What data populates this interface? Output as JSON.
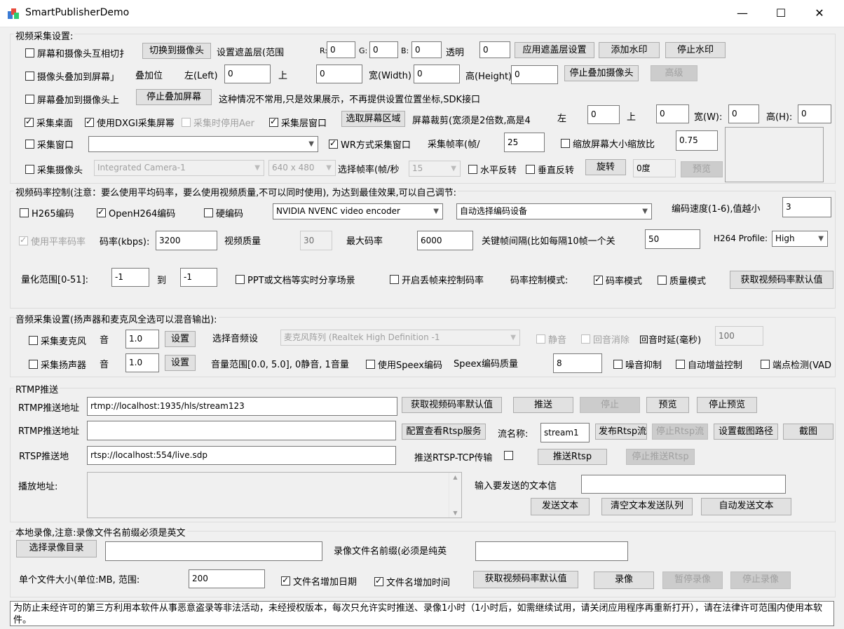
{
  "window": {
    "title": "SmartPublisherDemo"
  },
  "video_capture": {
    "group_label": "视频采集设置:",
    "swap_check": "屏幕和摄像头互相切扌",
    "switch_camera_btn": "切换到摄像头",
    "mask_range_label": "设置遮盖层(范围",
    "r_label": "R:",
    "r_value": "0",
    "g_label": "G:",
    "g_value": "0",
    "b_label": "B:",
    "b_value": "0",
    "alpha_label": "透明",
    "alpha_value": "0",
    "apply_mask_btn": "应用遮盖层设置",
    "add_watermark_btn": "添加水印",
    "stop_watermark_btn": "停止水印",
    "camera_overlay_check": "摄像头叠加到屏幕」",
    "overlay_pos_label": "叠加位",
    "left_label": "左(Left)",
    "left_value": "0",
    "up_label": "上",
    "up_value": "0",
    "width_label": "宽(Width)",
    "width_value": "0",
    "height_label": "高(Height)",
    "height_value": "0",
    "stop_overlay_camera_btn": "停止叠加摄像头",
    "advanced_btn": "高级",
    "screen_overlay_check": "屏幕叠加到摄像头上",
    "stop_overlay_screen_btn": "停止叠加屏幕",
    "overlay_note": "这种情况不常用,只是效果展示，不再提供设置位置坐标,SDK接口",
    "capture_desktop_check": "采集桌面",
    "use_dxgi_check": "使用DXGI采集屏幂",
    "disable_aero_check": "采集时停用Aer",
    "capture_layer_check": "采集层窗口",
    "select_region_btn": "选取屏幕区域",
    "crop_label": "屏幕裁剪(宽须是2倍数,高是4",
    "crop_left_label": "左",
    "crop_left_value": "0",
    "crop_up_label": "上",
    "crop_up_value": "0",
    "crop_w_label": "宽(W):",
    "crop_w_value": "0",
    "crop_h_label": "高(H):",
    "crop_h_value": "0",
    "capture_window_check": "采集窗口",
    "window_select": "",
    "wr_check": "WR方式采集窗口",
    "fps_label": "采集帧率(帧/",
    "fps_value": "25",
    "scale_check": "缩放屏幕大小缩放比",
    "scale_value": "0.75",
    "capture_camera_check": "采集摄像头",
    "camera_select": "Integrated Camera-1",
    "resolution_select": "640 x 480",
    "select_fps_label": "选择帧率(帧/秒",
    "select_fps_value": "15",
    "hflip_check": "水平反转",
    "vflip_check": "垂直反转",
    "rotate_btn": "旋转",
    "rotate_value": "0度",
    "preview_btn": "预览"
  },
  "bitrate": {
    "group_label": "视频码率控制(注意：要么使用平均码率，要么使用视频质量,不可以同时使用), 为达到最佳效果,可以自己调节:",
    "h265_check": "H265编码",
    "openh264_check": "OpenH264编码",
    "hw_check": "硬编码",
    "encoder_select": "NVIDIA NVENC video encoder",
    "device_select": "自动选择编码设备",
    "speed_label": "编码速度(1-6),值越小",
    "speed_value": "3",
    "avg_bitrate_check": "使用平率码率",
    "bitrate_label": "码率(kbps):",
    "bitrate_value": "3200",
    "quality_label": "视频质量",
    "quality_value": "30",
    "max_bitrate_label": "最大码率",
    "max_bitrate_value": "6000",
    "keyframe_label": "关键帧间隔(比如每隔10帧一个关",
    "keyframe_value": "50",
    "profile_label": "H264 Profile:",
    "profile_value": "High",
    "quant_label": "量化范围[0-51]:",
    "quant_min": "-1",
    "to_label": "到",
    "quant_max": "-1",
    "ppt_check": "PPT或文档等实时分享场景",
    "drop_frame_check": "开启丢帧来控制码率",
    "rc_mode_label": "码率控制模式:",
    "rc_bitrate_check": "码率模式",
    "rc_quality_check": "质量模式",
    "get_default_btn": "获取视频码率默认值"
  },
  "audio": {
    "group_label": "音频采集设置(扬声器和麦克风全选可以混音输出):",
    "mic_check": "采集麦克风",
    "mic_vol_label": "音",
    "mic_vol_value": "1.0",
    "mic_set_btn": "设置",
    "audio_dev_label": "选择音频设",
    "audio_dev_select": "麦克风阵列 (Realtek High Definition -1",
    "mute_check": "静音",
    "echo_cancel_check": "回音消除",
    "echo_delay_label": "回音时延(毫秒)",
    "echo_delay_value": "100",
    "speaker_check": "采集扬声器",
    "spk_vol_label": "音",
    "spk_vol_value": "1.0",
    "spk_set_btn": "设置",
    "vol_range_label": "音量范围[0.0, 5.0], 0静音, 1音量",
    "speex_check": "使用Speex编码",
    "speex_quality_label": "Speex编码质量",
    "speex_quality_value": "8",
    "noise_check": "噪音抑制",
    "agc_check": "自动增益控制",
    "vad_check": "端点检测(VAD"
  },
  "rtmp": {
    "group_label": "RTMP推送",
    "url1_label": "RTMP推送地址",
    "url1_value": "rtmp://localhost:1935/hls/stream123",
    "get_default_btn": "获取视频码率默认值",
    "push_btn": "推送",
    "stop_btn": "停止",
    "preview_btn": "预览",
    "stop_preview_btn": "停止预览",
    "url2_label": "RTMP推送地址",
    "url2_value": "",
    "rtsp_service_btn": "配置查看Rtsp服务",
    "stream_name_label": "流名称:",
    "stream_name_value": "stream1",
    "publish_rtsp_btn": "发布Rtsp流",
    "stop_rtsp_btn": "停止Rtsp流",
    "snapshot_path_btn": "设置截图路径",
    "snapshot_btn": "截图",
    "rtsp_label": "RTSP推送地",
    "rtsp_value": "rtsp://localhost:554/live.sdp",
    "rtsp_tcp_label": "推送RTSP-TCP传输",
    "push_rtsp_btn": "推送Rtsp",
    "stop_push_rtsp_btn": "停止推送Rtsp",
    "play_url_label": "播放地址:",
    "text_input_label": "输入要发送的文本信",
    "text_input_value": "",
    "send_text_btn": "发送文本",
    "clear_text_btn": "清空文本发送队列",
    "auto_send_btn": "自动发送文本"
  },
  "record": {
    "group_label": "本地录像,注意:录像文件名前缀必须是英文",
    "select_dir_btn": "选择录像目录",
    "dir_value": "",
    "prefix_label": "录像文件名前缀(必须是纯英",
    "prefix_value": "",
    "file_size_label": "单个文件大小(单位:MB, 范围:",
    "file_size_value": "200",
    "add_date_check": "文件名增加日期",
    "add_time_check": "文件名增加时间",
    "get_default_btn": "获取视频码率默认值",
    "record_btn": "录像",
    "pause_btn": "暂停录像",
    "stop_btn": "停止录像"
  },
  "footer": {
    "notice": "为防止未经许可的第三方利用本软件从事恶意盗录等非法活动，未经授权版本，每次只允许实时推送、录像1小时（1小时后，如需继续试用，请关闭应用程序再重新打开），请在法律许可范围内使用本软件。"
  }
}
